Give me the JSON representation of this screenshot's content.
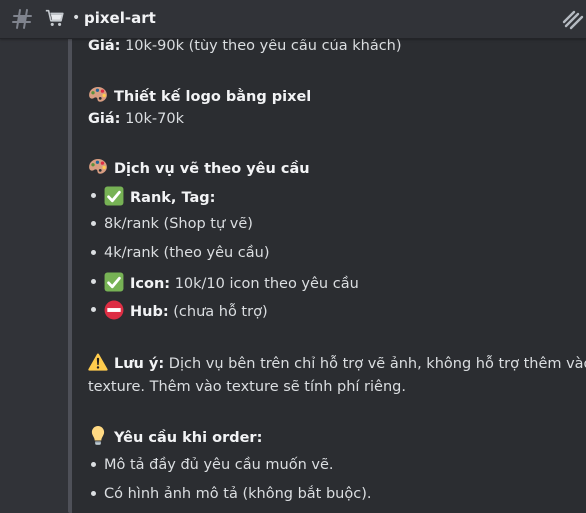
{
  "header": {
    "channel_name": "pixel-art",
    "separator": "•"
  },
  "message": {
    "partial_top_line": {
      "label": "Giá:",
      "value": "10k-90k (tùy theo yêu cầu của khách)"
    },
    "logo_section": {
      "title": "Thiết kế logo bằng pixel",
      "price_label": "Giá:",
      "price_value": "10k-70k"
    },
    "custom_section": {
      "title": "Dịch vụ vẽ theo yêu cầu",
      "items": [
        {
          "icon": "check-icon",
          "label": "Rank, Tag:",
          "value": ""
        },
        {
          "icon": "",
          "label": "",
          "value": "8k/rank (Shop tự vẽ)"
        },
        {
          "icon": "",
          "label": "",
          "value": "4k/rank (theo yêu cầu)"
        },
        {
          "icon": "check-icon",
          "label": "Icon:",
          "value": "10k/10 icon theo yêu cầu"
        },
        {
          "icon": "no-entry-icon",
          "label": "Hub:",
          "value": "(chưa hỗ trợ)"
        }
      ]
    },
    "note": {
      "label": "Lưu ý:",
      "text_line1": "Dịch vụ bên trên chỉ hỗ trợ vẽ ảnh, không hỗ trợ thêm vào",
      "text_line2": "texture. Thêm vào texture sẽ tính phí riêng."
    },
    "order_requirements": {
      "title": "Yêu cầu khi order:",
      "items": [
        "Mô tả đầy đủ yêu cầu muốn vẽ.",
        "Có hình ảnh mô tả (không bắt buộc)."
      ]
    }
  },
  "colors": {
    "background": "#313338",
    "embed_background": "#2b2d31",
    "embed_bar": "#4e5058",
    "text": "#dbdee1",
    "check_green": "#77b255",
    "no_entry_red": "#dd2e44"
  }
}
